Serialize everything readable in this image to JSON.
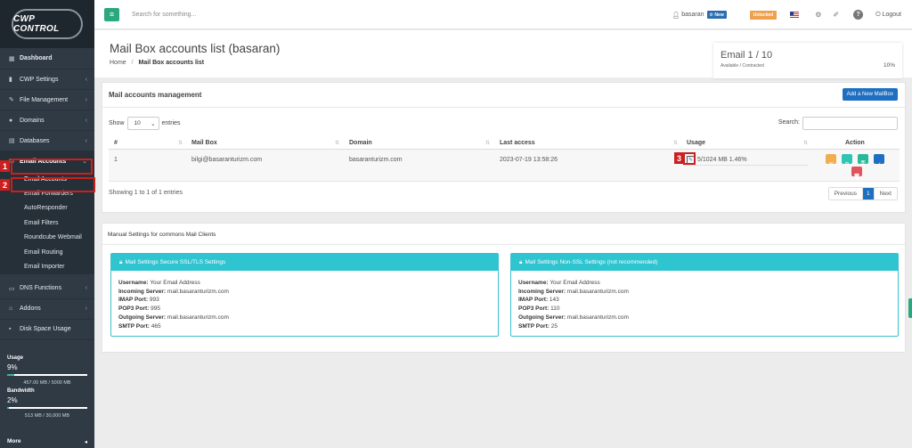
{
  "sidebar": {
    "logo_text": "CWP CONTROL",
    "items": [
      {
        "label": "Dashboard",
        "icon": "dashboard-icon"
      },
      {
        "label": "CWP Settings",
        "icon": "chart-icon"
      },
      {
        "label": "File Management",
        "icon": "edit-icon"
      },
      {
        "label": "Domains",
        "icon": "globe-icon"
      },
      {
        "label": "Databases",
        "icon": "database-icon"
      },
      {
        "label": "Email Accounts",
        "icon": "envelope-icon"
      }
    ],
    "email_sub": [
      "Email Accounts",
      "Email Forwarders",
      "AutoResponder",
      "Email Filters",
      "Roundcube Webmail",
      "Email Routing",
      "Email Importer"
    ],
    "items_after": [
      {
        "label": "DNS Functions",
        "icon": "server-icon"
      },
      {
        "label": "Addons",
        "icon": "bank-icon"
      },
      {
        "label": "Disk Space Usage",
        "icon": "disk-icon"
      }
    ],
    "usage_label": "Usage",
    "usage_pct": "9%",
    "usage_fraction": 0.09,
    "usage_value": "457.00 MB / 5000 MB",
    "bandwidth_label": "Bandwidth",
    "bandwidth_pct": "2%",
    "bandwidth_fraction": 0.02,
    "bandwidth_value": "513 MB / 30,000 MB",
    "more_label": "More"
  },
  "annotations": {
    "m1": "1",
    "m2": "2",
    "m3": "3"
  },
  "topbar": {
    "search_placeholder": "Search for something...",
    "username": "basaran",
    "new_badge": "New",
    "unlocked_badge": "Unlocked",
    "logout": "Logout"
  },
  "header": {
    "title": "Mail Box accounts list (basaran)",
    "breadcrumb_home": "Home",
    "breadcrumb_sep": "/",
    "breadcrumb_current": "Mail Box accounts list"
  },
  "quota": {
    "title": "Email 1 / 10",
    "subtitle": "Available / Contracted",
    "percent": "10%"
  },
  "accounts_panel": {
    "title": "Mail accounts management",
    "add_button": "Add a New MailBox",
    "show_label": "Show",
    "entries_value": "10",
    "entries_label": "entries",
    "search_label": "Search:",
    "columns": [
      "#",
      "Mail Box",
      "Domain",
      "Last access",
      "Usage",
      "Action"
    ],
    "row": {
      "index": "1",
      "mailbox": "bilgi@basaranturizm.com",
      "domain": "basaranturizm.com",
      "last_access": "2023-07-19 13:58:26",
      "usage": "5/1024 MB 1.46%"
    },
    "showing": "Showing 1 to 1 of 1 entries",
    "pager": {
      "previous": "Previous",
      "page": "1",
      "next": "Next"
    }
  },
  "manual": {
    "title": "Manual Settings for commons Mail Clients",
    "ssl": {
      "heading": "Mail Settings Secure SSL/TLS Settings",
      "username_label": "Username:",
      "username": "Your Email Address",
      "incoming_label": "Incoming Server:",
      "incoming": "mail.basaranturizm.com",
      "imap_label": "IMAP Port:",
      "imap": "993",
      "pop3_label": "POP3 Port:",
      "pop3": "995",
      "outgoing_label": "Outgoing Server:",
      "outgoing": "mail.basaranturizm.com",
      "smtp_label": "SMTP Port:",
      "smtp": "465"
    },
    "nonssl": {
      "heading": "Mail Settings Non-SSL Settings (not recommended)",
      "username_label": "Username:",
      "username": "Your Email Address",
      "incoming_label": "Incoming Server:",
      "incoming": "mail.basaranturizm.com",
      "imap_label": "IMAP Port:",
      "imap": "143",
      "pop3_label": "POP3 Port:",
      "pop3": "110",
      "outgoing_label": "Outgoing Server:",
      "outgoing": "mail.basaranturizm.com",
      "smtp_label": "SMTP Port:",
      "smtp": "25"
    }
  },
  "colors": {
    "sidebar": "#2f3a45",
    "accent": "#2aa87f",
    "primary": "#1f6fc1",
    "cyan": "#2ec4d0",
    "highlight": "#cc1f1f"
  }
}
